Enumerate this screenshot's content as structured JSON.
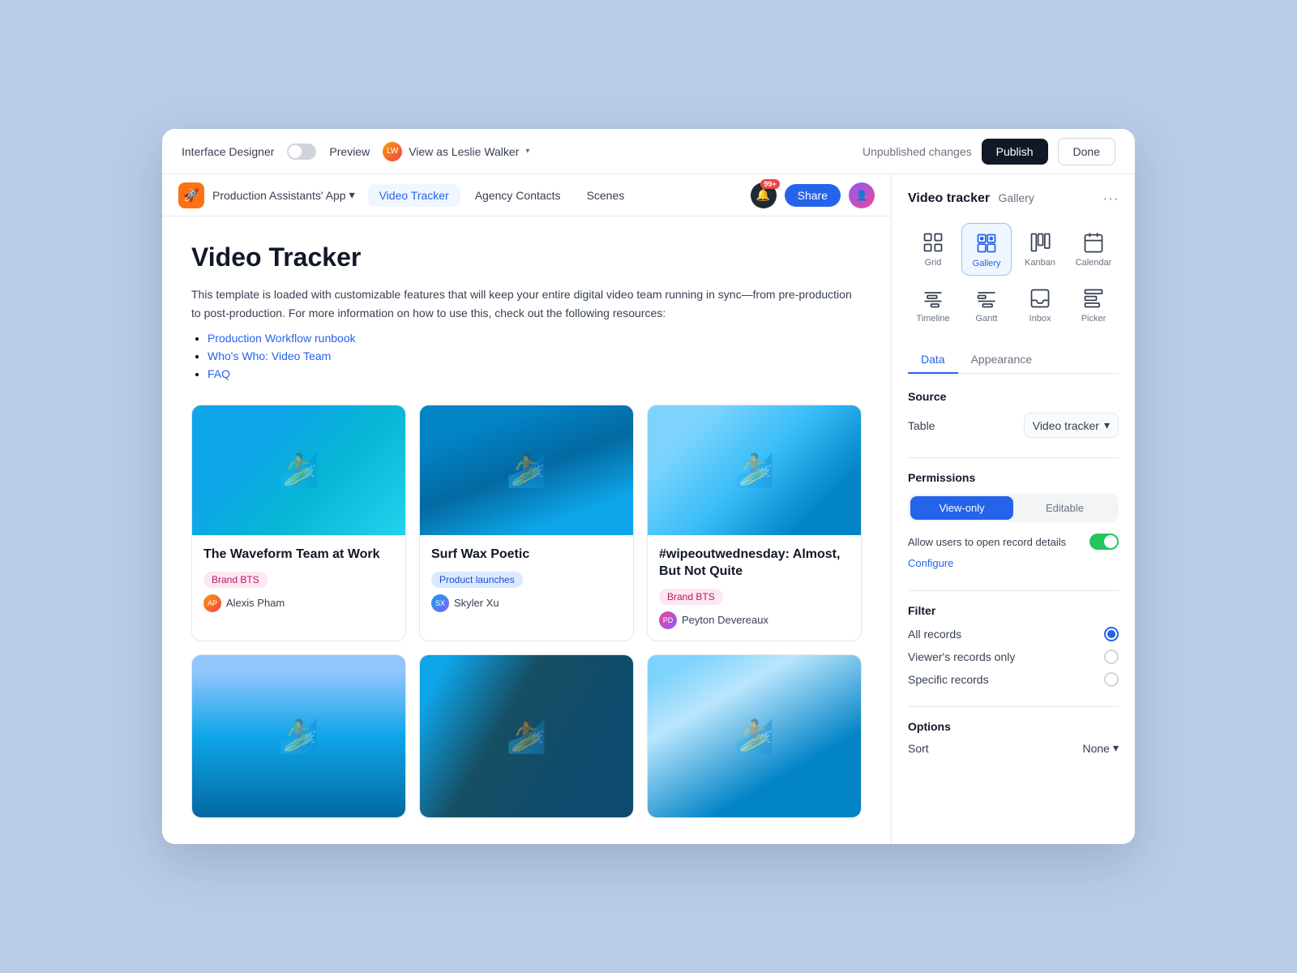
{
  "topbar": {
    "interface_designer": "Interface Designer",
    "preview": "Preview",
    "view_as": "View as Leslie Walker",
    "unpublished": "Unpublished changes",
    "publish": "Publish",
    "done": "Done"
  },
  "navbar": {
    "app_name": "Production Assistants' App",
    "tabs": [
      {
        "label": "Video Tracker",
        "active": true
      },
      {
        "label": "Agency Contacts",
        "active": false
      },
      {
        "label": "Scenes",
        "active": false
      }
    ],
    "badge_count": "99+",
    "share": "Share"
  },
  "page": {
    "title": "Video Tracker",
    "description": "This template is loaded with customizable features that will keep your entire digital video team running in sync—from pre-production to post-production. For more information on how to use this, check out the following resources:",
    "links": [
      "Production Workflow runbook",
      "Who's Who: Video Team",
      "FAQ"
    ]
  },
  "cards": [
    {
      "title": "The Waveform Team at Work",
      "tag": "Brand BTS",
      "tag_class": "tag-pink",
      "author": "Alexis Pham"
    },
    {
      "title": "Surf Wax Poetic",
      "tag": "Product launches",
      "tag_class": "tag-blue",
      "author": "Skyler Xu"
    },
    {
      "title": "#wipeoutwednesday: Almost, But Not Quite",
      "tag": "Brand BTS",
      "tag_class": "tag-pink",
      "author": "Peyton Devereaux"
    }
  ],
  "panel": {
    "title": "Video tracker",
    "subtitle": "Gallery",
    "views": [
      {
        "label": "Grid",
        "icon": "grid"
      },
      {
        "label": "Gallery",
        "icon": "gallery",
        "active": true
      },
      {
        "label": "Kanban",
        "icon": "kanban"
      },
      {
        "label": "Calendar",
        "icon": "calendar"
      },
      {
        "label": "Timeline",
        "icon": "timeline"
      },
      {
        "label": "Gantt",
        "icon": "gantt"
      },
      {
        "label": "Inbox",
        "icon": "inbox"
      },
      {
        "label": "Picker",
        "icon": "picker"
      }
    ],
    "tabs": [
      {
        "label": "Data",
        "active": true
      },
      {
        "label": "Appearance",
        "active": false
      }
    ],
    "source": {
      "label": "Table",
      "value": "Video tracker"
    },
    "permissions": {
      "title": "Permissions",
      "view_only": "View-only",
      "editable": "Editable",
      "allow_text": "Allow users to open record details",
      "configure": "Configure"
    },
    "filter": {
      "title": "Filter",
      "options": [
        {
          "label": "All records",
          "selected": true
        },
        {
          "label": "Viewer's records only",
          "selected": false
        },
        {
          "label": "Specific records",
          "selected": false
        }
      ]
    },
    "options": {
      "title": "Options",
      "sort_label": "Sort",
      "sort_value": "None"
    }
  }
}
